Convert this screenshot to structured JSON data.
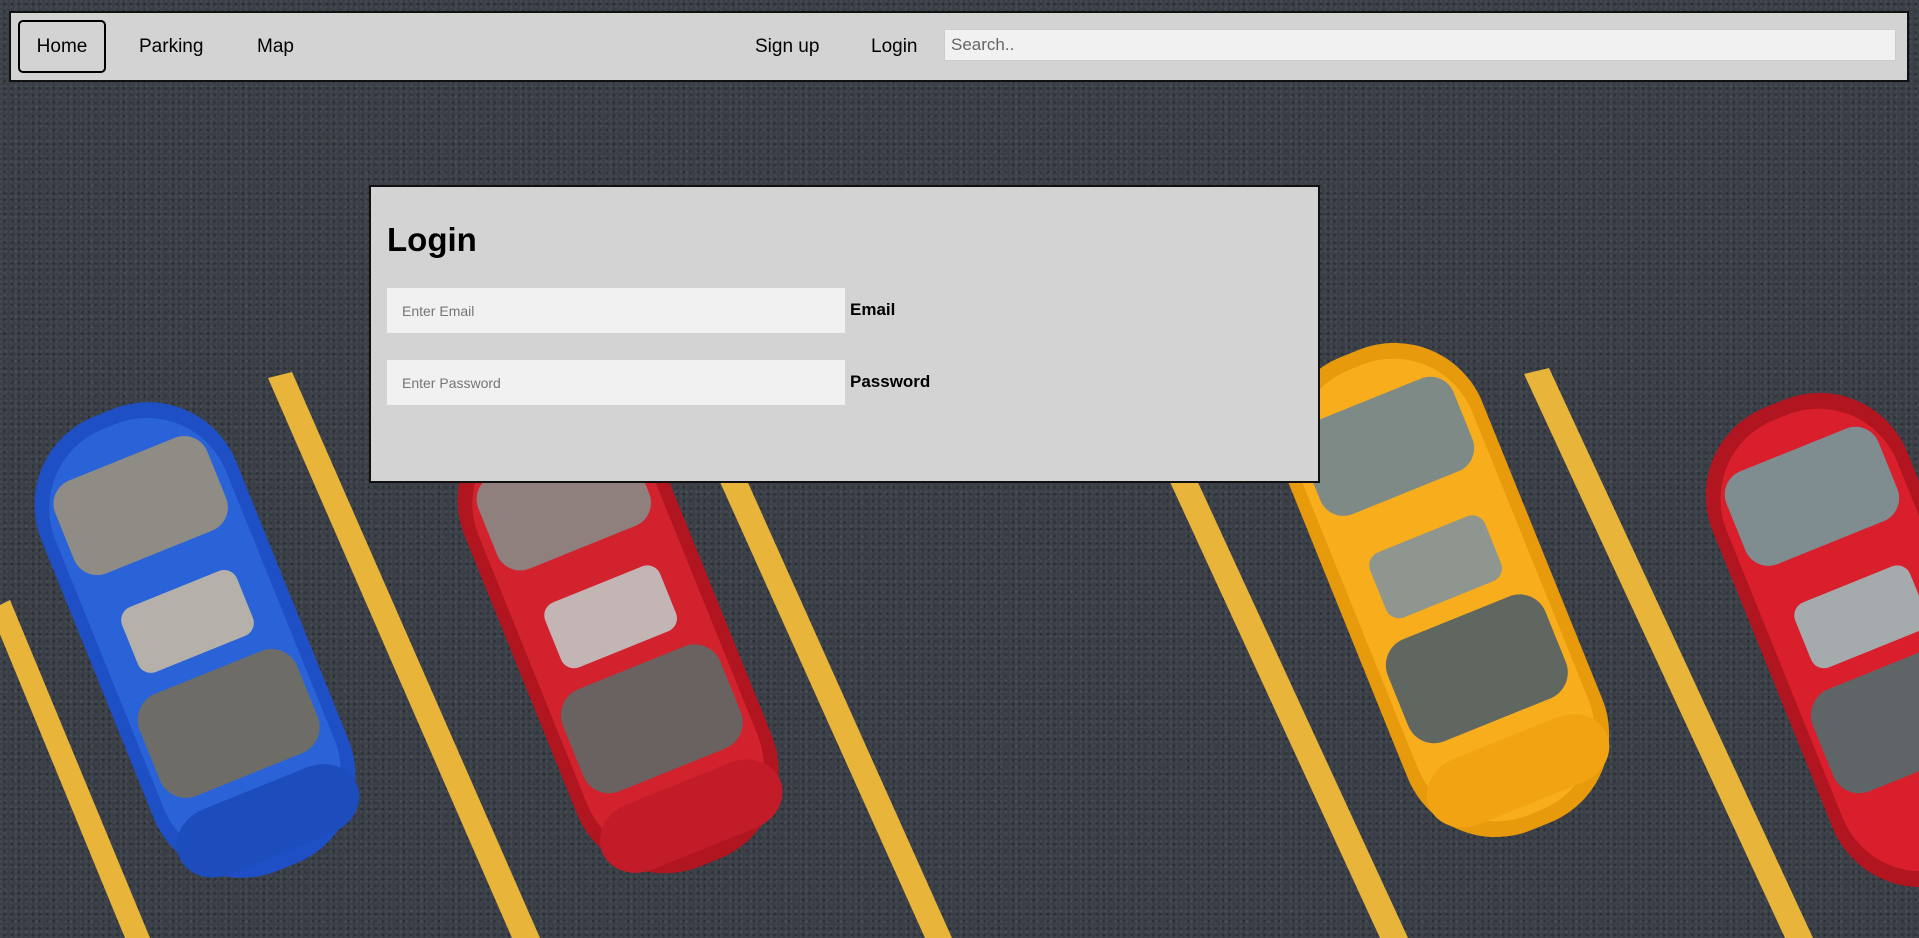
{
  "navbar": {
    "home_label": "Home",
    "parking_label": "Parking",
    "map_label": "Map",
    "signup_label": "Sign up",
    "login_label": "Login",
    "search_placeholder": "Search.."
  },
  "login_form": {
    "title": "Login",
    "email_placeholder": "Enter Email",
    "email_label": "Email",
    "password_placeholder": "Enter Password",
    "password_label": "Password"
  },
  "colors": {
    "panel_bg": "#d3d3d3",
    "input_bg": "#f1f1f1",
    "asphalt": "#3a3f47",
    "parking_line": "#e8b53a"
  },
  "background": {
    "image_subject": "parking-lot-with-cars"
  }
}
